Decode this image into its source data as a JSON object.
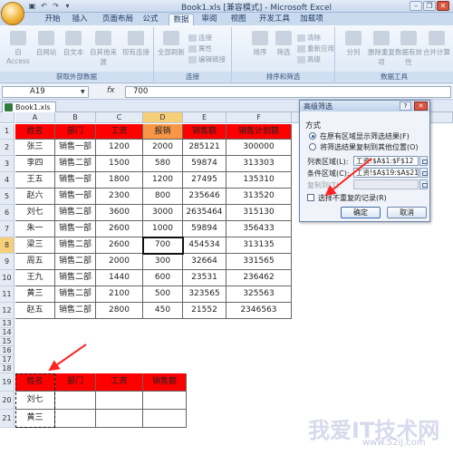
{
  "window": {
    "title": "Book1.xls [兼容模式] - Microsoft Excel"
  },
  "ribbon_tabs": [
    "开始",
    "插入",
    "页面布局",
    "公式",
    "数据",
    "审阅",
    "视图",
    "开发工具",
    "加载项"
  ],
  "active_tab": "数据",
  "ribbon": {
    "external_data": {
      "label": "获取外部数据",
      "buttons": [
        "自 Access",
        "自网站",
        "自文本",
        "自其他来源",
        "现有连接"
      ]
    },
    "connections": {
      "label": "连接",
      "buttons": [
        "全部刷新",
        "连接",
        "属性",
        "编辑链接"
      ]
    },
    "sort_filter": {
      "label": "排序和筛选",
      "buttons": [
        "排序",
        "筛选",
        "清除",
        "重新应用",
        "高级"
      ]
    },
    "data_tools": {
      "label": "数据工具",
      "buttons": [
        "分列",
        "删除重复项",
        "数据有效性",
        "合并计算"
      ]
    }
  },
  "formula_bar": {
    "name_box": "A19",
    "fx": "fx",
    "value": "700"
  },
  "workbook_tab": "Book1.xls",
  "columns": [
    "A",
    "B",
    "C",
    "D",
    "E",
    "F"
  ],
  "rows": [
    "1",
    "2",
    "3",
    "4",
    "5",
    "6",
    "7",
    "8",
    "9",
    "10",
    "11",
    "12",
    "13",
    "14",
    "15",
    "16",
    "17",
    "18",
    "19",
    "20",
    "21"
  ],
  "table": {
    "headers": [
      "姓名",
      "部门",
      "工资",
      "报销",
      "销售额",
      "销售计划额"
    ],
    "rows": [
      [
        "张三",
        "销售一部",
        "1200",
        "2000",
        "285121",
        "300000"
      ],
      [
        "李四",
        "销售二部",
        "1500",
        "580",
        "59874",
        "313303"
      ],
      [
        "王五",
        "销售一部",
        "1800",
        "1200",
        "27495",
        "135310"
      ],
      [
        "赵六",
        "销售一部",
        "2300",
        "800",
        "235646",
        "313520"
      ],
      [
        "刘七",
        "销售二部",
        "3600",
        "3000",
        "2635464",
        "315130"
      ],
      [
        "朱一",
        "销售一部",
        "2600",
        "1000",
        "59894",
        "356433"
      ],
      [
        "梁三",
        "销售二部",
        "2600",
        "700",
        "454534",
        "313135"
      ],
      [
        "周五",
        "销售二部",
        "2000",
        "300",
        "32664",
        "331565"
      ],
      [
        "王九",
        "销售二部",
        "1440",
        "600",
        "23531",
        "236462"
      ],
      [
        "黄三",
        "销售二部",
        "2100",
        "500",
        "323565",
        "325563"
      ],
      [
        "赵五",
        "销售二部",
        "2800",
        "450",
        "21552",
        "2346563"
      ]
    ]
  },
  "criteria": {
    "headers": [
      "姓名",
      "部门",
      "工资",
      "销售额"
    ],
    "rows": [
      [
        "刘七",
        "",
        "",
        ""
      ],
      [
        "黄三",
        "",
        "",
        ""
      ]
    ]
  },
  "dialog": {
    "title": "高级筛选",
    "help": "?",
    "close": "✕",
    "method_label": "方式",
    "option1": "在原有区域显示筛选结果(F)",
    "option2": "将筛选结果复制到其他位置(O)",
    "list_range_label": "列表区域(L):",
    "list_range_value": "工资!$A$1:$F$12",
    "criteria_range_label": "条件区域(C):",
    "criteria_range_value": "工资!$A$19:$A$21",
    "copy_to_label": "复制到(T):",
    "copy_to_value": "",
    "unique_label": "选择不重复的记录(R)",
    "ok": "确定",
    "cancel": "取消"
  },
  "watermark": {
    "main": "我爱IT技术网",
    "sub": "www.52ij.com"
  }
}
